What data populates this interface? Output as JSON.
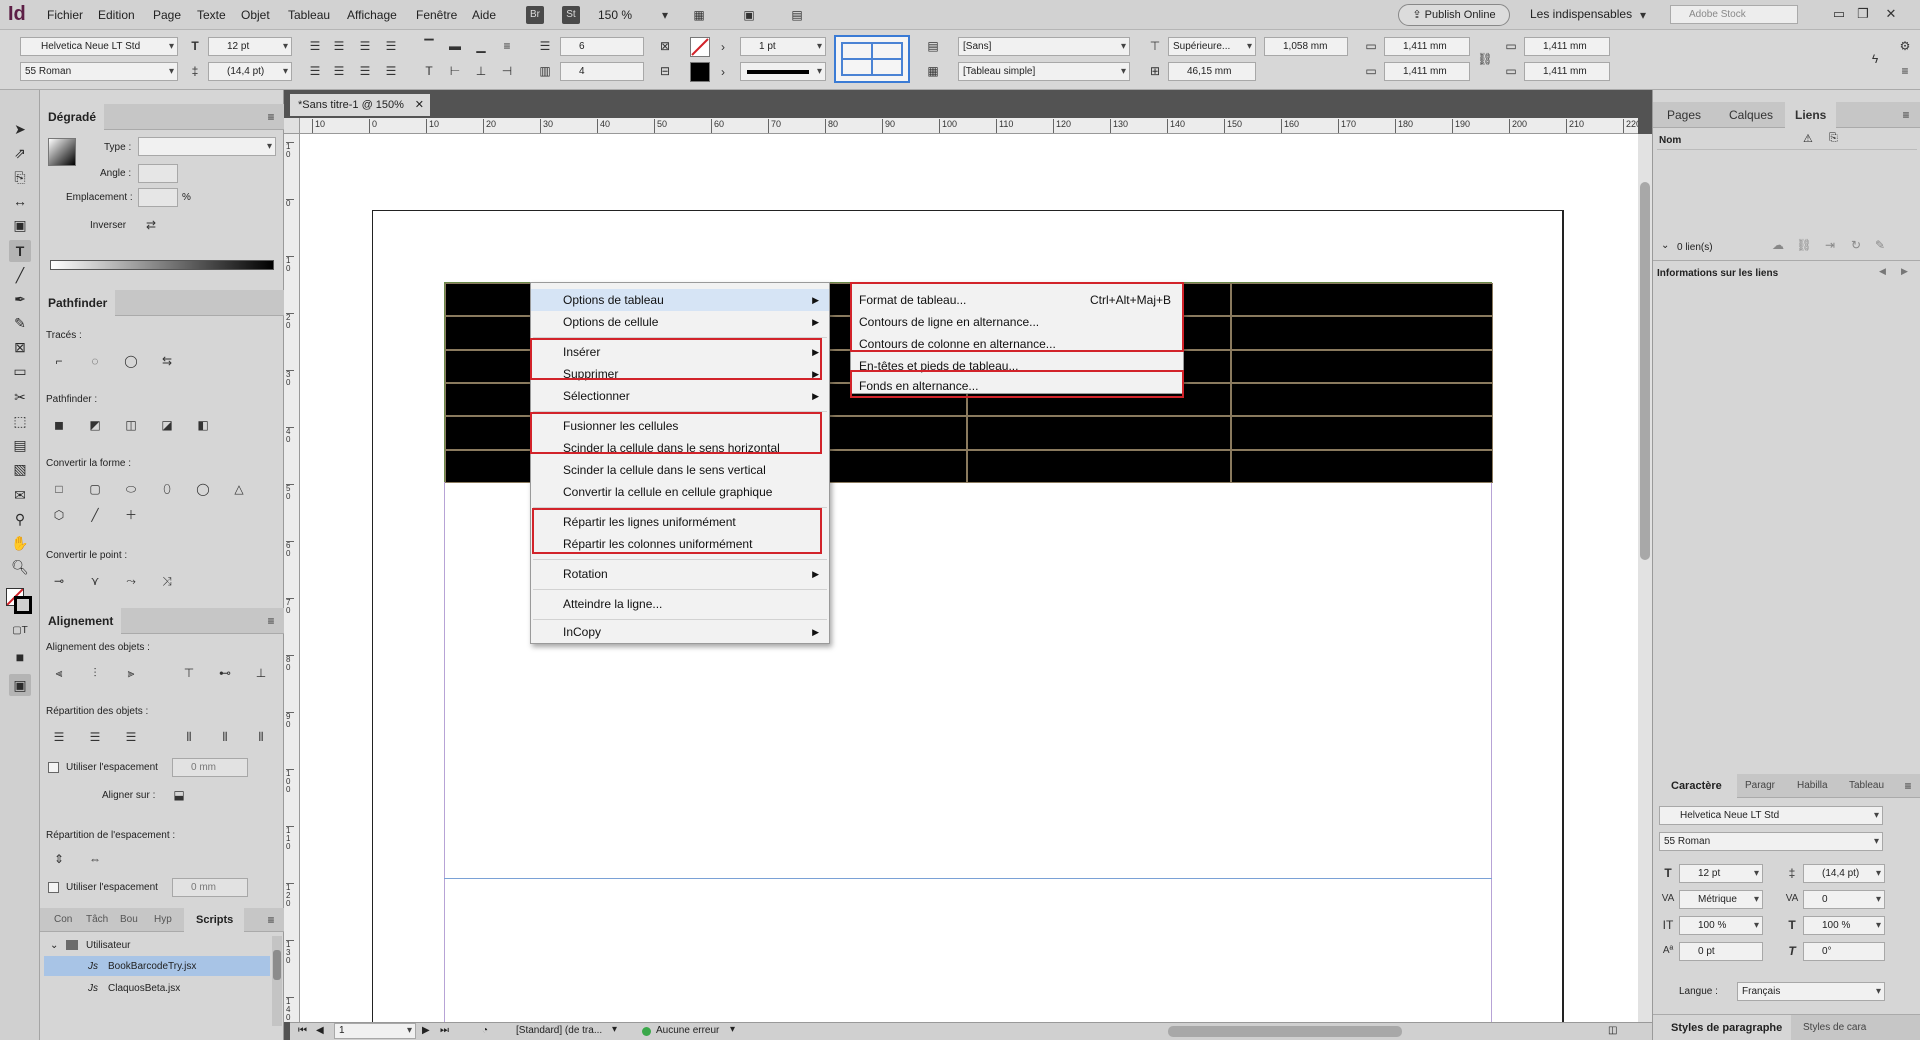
{
  "app": {
    "logo": "Id",
    "menus": [
      "Fichier",
      "Edition",
      "Page",
      "Texte",
      "Objet",
      "Tableau",
      "Affichage",
      "Fenêtre",
      "Aide"
    ],
    "chips": [
      "Br",
      "St"
    ],
    "zoom": "150 %",
    "publish": "Publish Online",
    "workspace": "Les indispensables",
    "stock_search": "Adobe Stock"
  },
  "control": {
    "font": "Helvetica Neue LT Std",
    "style": "55 Roman",
    "size": "12 pt",
    "leading": "(14,4 pt)",
    "rows": "6",
    "cols": "4",
    "stroke_weight": "1 pt",
    "cell_style": "[Sans]",
    "table_style": "[Tableau simple]",
    "valign": "Supérieure...",
    "row_height": "1,058 mm",
    "col_width": "46,15 mm",
    "inset_top": "1,411 mm",
    "inset_bottom": "1,411 mm",
    "inset_left": "1,411 mm",
    "inset_right": "1,411 mm"
  },
  "left": {
    "gradient_title": "Dégradé",
    "type_label": "Type :",
    "angle_label": "Angle :",
    "location_label": "Emplacement :",
    "percent": "%",
    "reverse_label": "Inverser",
    "pathfinder_title": "Pathfinder",
    "paths_label": "Tracés :",
    "pathfinder_label": "Pathfinder :",
    "convert_shape_label": "Convertir la forme :",
    "convert_point_label": "Convertir le point :",
    "align_title": "Alignement",
    "align_objects_label": "Alignement des objets :",
    "distribute_objects_label": "Répartition des objets :",
    "use_spacing_label": "Utiliser l'espacement",
    "spacing_value": "0 mm",
    "align_to_label": "Aligner sur :",
    "distribute_spacing_label": "Répartition de l'espacement :",
    "use_spacing_label2": "Utiliser l'espacement",
    "spacing_value2": "0 mm",
    "bottom_tabs": [
      "Con",
      "Tâch",
      "Bou",
      "Hyp",
      "Scripts"
    ],
    "scripts_folder": "Utilisateur",
    "scripts": [
      "BookBarcodeTry.jsx",
      "ClaquosBeta.jsx"
    ]
  },
  "document": {
    "tab_title": "*Sans titre-1 @ 150%",
    "ruler_h": [
      "10",
      "0",
      "10",
      "20",
      "30",
      "40",
      "50",
      "60",
      "70",
      "80",
      "90",
      "100",
      "110",
      "120",
      "130",
      "140",
      "150",
      "160",
      "170",
      "180",
      "190",
      "200",
      "210",
      "220"
    ],
    "ruler_v": [
      "1 0",
      "0",
      "1 0",
      "2 0",
      "3 0",
      "4 0",
      "5 0",
      "6 0",
      "7 0",
      "8 0",
      "9 0",
      "1 0 0",
      "1 1 0",
      "1 2 0",
      "1 3 0",
      "1 4 0"
    ],
    "page_field": "1",
    "preflight_profile": "[Standard] (de tra...",
    "preflight_status": "Aucune erreur"
  },
  "context_menu": {
    "items": [
      "Options de tableau",
      "Options de cellule",
      "Insérer",
      "Supprimer",
      "Sélectionner",
      "Fusionner les cellules",
      "Scinder la cellule dans le sens horizontal",
      "Scinder la cellule dans le sens vertical",
      "Convertir la cellule en cellule graphique",
      "Répartir les lignes uniformément",
      "Répartir les colonnes uniformément",
      "Rotation",
      "Atteindre la ligne...",
      "InCopy"
    ],
    "submenu": [
      "Format de tableau...",
      "Contours de ligne en alternance...",
      "Contours de colonne en alternance...",
      "En-têtes et pieds de tableau...",
      "Fonds en alternance..."
    ],
    "shortcut": "Ctrl+Alt+Maj+B"
  },
  "right": {
    "tabs": [
      "Pages",
      "Calques",
      "Liens"
    ],
    "col_name": "Nom",
    "links_count": "0 lien(s)",
    "link_info": "Informations sur les liens",
    "char_tabs": [
      "Caractère",
      "Paragr",
      "Habilla",
      "Tableau"
    ],
    "font": "Helvetica Neue LT Std",
    "style": "55 Roman",
    "size": "12 pt",
    "leading": "(14,4 pt)",
    "kerning": "Métrique",
    "tracking": "0",
    "vscale": "100 %",
    "hscale": "100 %",
    "baseline": "0 pt",
    "skew": "0°",
    "language_label": "Langue :",
    "language": "Français",
    "bottom_tabs": [
      "Styles de paragraphe",
      "Styles de cara"
    ]
  },
  "colors": {
    "accent_red": "#d2232a",
    "selection_blue": "#a8c4e6",
    "cell_fill": "#000000"
  }
}
